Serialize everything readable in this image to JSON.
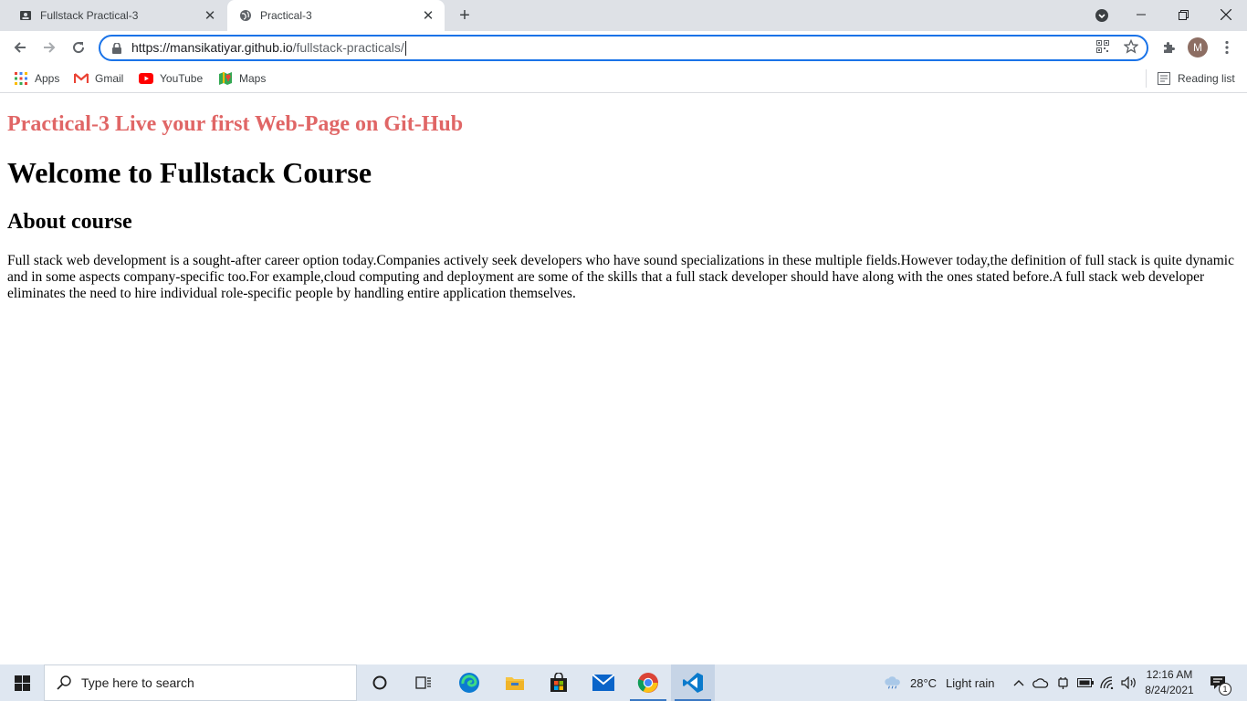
{
  "browser": {
    "tabs": [
      {
        "title": "Fullstack Practical-3",
        "active": false
      },
      {
        "title": "Practical-3",
        "active": true
      }
    ],
    "url_host": "https://mansikatiyar.github.io",
    "url_path": "/fullstack-practicals/",
    "profile_initial": "M",
    "bookmarks": [
      {
        "label": "Apps",
        "icon": "apps-grid-icon"
      },
      {
        "label": "Gmail",
        "icon": "gmail-icon"
      },
      {
        "label": "YouTube",
        "icon": "youtube-icon"
      },
      {
        "label": "Maps",
        "icon": "maps-icon"
      }
    ],
    "reading_list": "Reading list"
  },
  "page": {
    "heading_practical": "Practical-3 Live your first Web-Page on Git-Hub",
    "heading_welcome": "Welcome to Fullstack Course",
    "heading_about": "About course",
    "paragraph": "Full stack web development is a sought-after career option today.Companies actively seek developers who have sound specializations in these multiple fields.However today,the definition of full stack is quite dynamic and in some aspects company-specific too.For example,cloud computing and deployment are some of the skills that a full stack developer should have along with the ones stated before.A full stack web developer eliminates the need to hire individual role-specific people by handling entire application themselves."
  },
  "taskbar": {
    "search_placeholder": "Type here to search",
    "weather_temp": "28°C",
    "weather_desc": "Light rain",
    "time": "12:16 AM",
    "date": "8/24/2021",
    "notification_count": "1"
  },
  "colors": {
    "heading_practical": "#e06666",
    "omnibox_focus": "#1a73e8",
    "tabstrip_bg": "#dee1e6",
    "taskbar_bg": "#dfe7f1"
  }
}
